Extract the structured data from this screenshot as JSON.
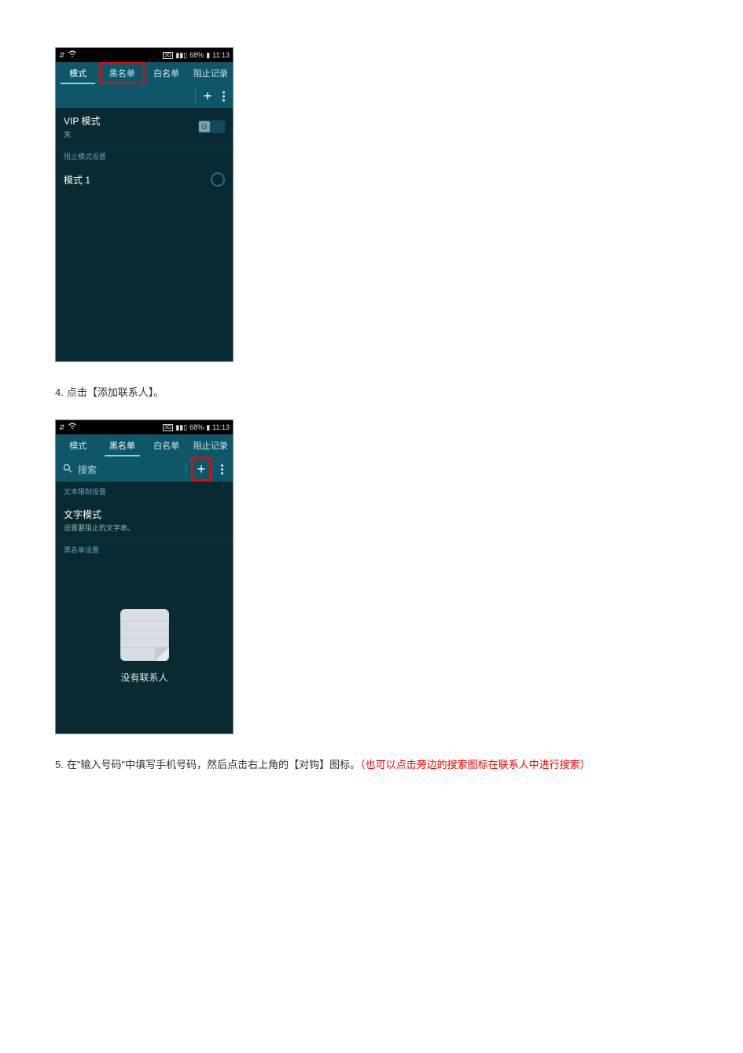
{
  "statusbar": {
    "time": "11:13",
    "battery": "68%",
    "network_badge": "3G"
  },
  "tabs": {
    "mode": "模式",
    "blacklist": "黑名单",
    "whitelist": "白名单",
    "blocklog": "阻止记录"
  },
  "screen1": {
    "vip_title": "VIP 模式",
    "vip_state": "关",
    "toggle_text": "O",
    "section_header": "阻止模式设置",
    "mode1": "模式 1"
  },
  "screen2": {
    "search_placeholder": "搜索",
    "section1": "文本限制设置",
    "text_mode_title": "文字模式",
    "text_mode_sub": "设置要阻止的文字串。",
    "section2": "黑名单设置",
    "empty": "没有联系人"
  },
  "instructions": {
    "step4_num": "4.",
    "step4_text": "点击【添加联系人】。",
    "step5_num": "5.",
    "step5_pre": "在",
    "step5_q1": "\"",
    "step5_field": "输入号码",
    "step5_q2": "\"",
    "step5_mid": "中填写手机号码，然后点击右上角的【对钩】图标。",
    "step5_red": "（也可以点击旁边的搜索图标在联系人中进行搜索）"
  }
}
